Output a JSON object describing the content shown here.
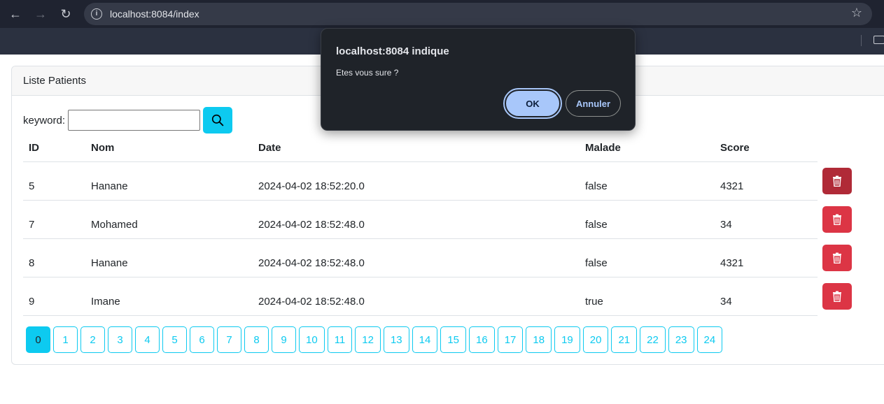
{
  "browser": {
    "url": "localhost:8084/index",
    "icons": [
      "back-icon",
      "forward-icon",
      "reload-icon",
      "info-icon",
      "star-icon",
      "folder-icon"
    ]
  },
  "card": {
    "title": "Liste Patients"
  },
  "search": {
    "label": "keyword:",
    "value": "",
    "placeholder": ""
  },
  "table": {
    "headers": [
      "ID",
      "Nom",
      "Date",
      "Malade",
      "Score"
    ],
    "rows": [
      [
        "5",
        "Hanane",
        "2024-04-02 18:52:20.0",
        "false",
        "4321"
      ],
      [
        "7",
        "Mohamed",
        "2024-04-02 18:52:48.0",
        "false",
        "34"
      ],
      [
        "8",
        "Hanane",
        "2024-04-02 18:52:48.0",
        "false",
        "4321"
      ],
      [
        "9",
        "Imane",
        "2024-04-02 18:52:48.0",
        "true",
        "34"
      ]
    ]
  },
  "pagination": {
    "current": "0",
    "pages": [
      "0",
      "1",
      "2",
      "3",
      "4",
      "5",
      "6",
      "7",
      "8",
      "9",
      "10",
      "11",
      "12",
      "13",
      "14",
      "15",
      "16",
      "17",
      "18",
      "19",
      "20",
      "21",
      "22",
      "23",
      "24"
    ]
  },
  "dialog": {
    "title": "localhost:8084 indique",
    "message": "Etes vous sure ?",
    "ok_label": "OK",
    "cancel_label": "Annuler"
  },
  "colors": {
    "info": "#0dcaf0",
    "danger": "#dc3545",
    "danger_active": "#b02a37",
    "dialog_bg": "#1f2329",
    "dialog_accent": "#a8c7fa"
  }
}
